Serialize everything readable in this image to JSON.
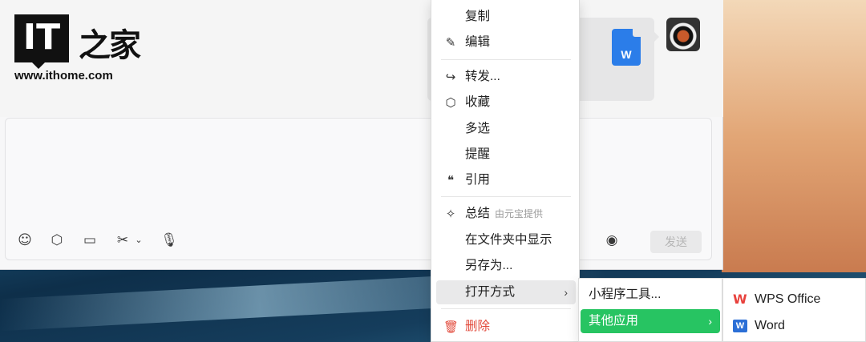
{
  "branding": {
    "logo_text": "IT之家",
    "url": "www.ithome.com"
  },
  "message": {
    "file_icon_letter": "W"
  },
  "composer": {
    "send_label": "发送",
    "toolbar_icons": [
      "emoji-icon",
      "cube-icon",
      "folder-icon",
      "scissors-icon",
      "chevron-down-icon",
      "microphone-icon",
      "voice-icon"
    ]
  },
  "context_menu": {
    "items": [
      {
        "label": "复制",
        "icon": ""
      },
      {
        "label": "编辑",
        "icon": "edit-icon"
      },
      {
        "label": "转发...",
        "icon": "forward-icon"
      },
      {
        "label": "收藏",
        "icon": "favorite-icon"
      },
      {
        "label": "多选",
        "icon": ""
      },
      {
        "label": "提醒",
        "icon": ""
      },
      {
        "label": "引用",
        "icon": "quote-icon"
      },
      {
        "label": "总结",
        "hint": "由元宝提供",
        "icon": "sparkle-icon"
      },
      {
        "label": "在文件夹中显示",
        "icon": ""
      },
      {
        "label": "另存为...",
        "icon": ""
      },
      {
        "label": "打开方式",
        "icon": ""
      },
      {
        "label": "删除",
        "icon": "trash-icon"
      }
    ]
  },
  "open_with_menu": {
    "items": [
      {
        "label": "小程序工具..."
      },
      {
        "label": "其他应用"
      }
    ]
  },
  "apps_menu": {
    "items": [
      {
        "label": "WPS Office",
        "icon": "wps-icon"
      },
      {
        "label": "Word",
        "icon": "word-icon"
      }
    ]
  },
  "colors": {
    "highlight": "#27c462",
    "danger": "#e24a3b",
    "word_blue": "#2b7de9"
  }
}
